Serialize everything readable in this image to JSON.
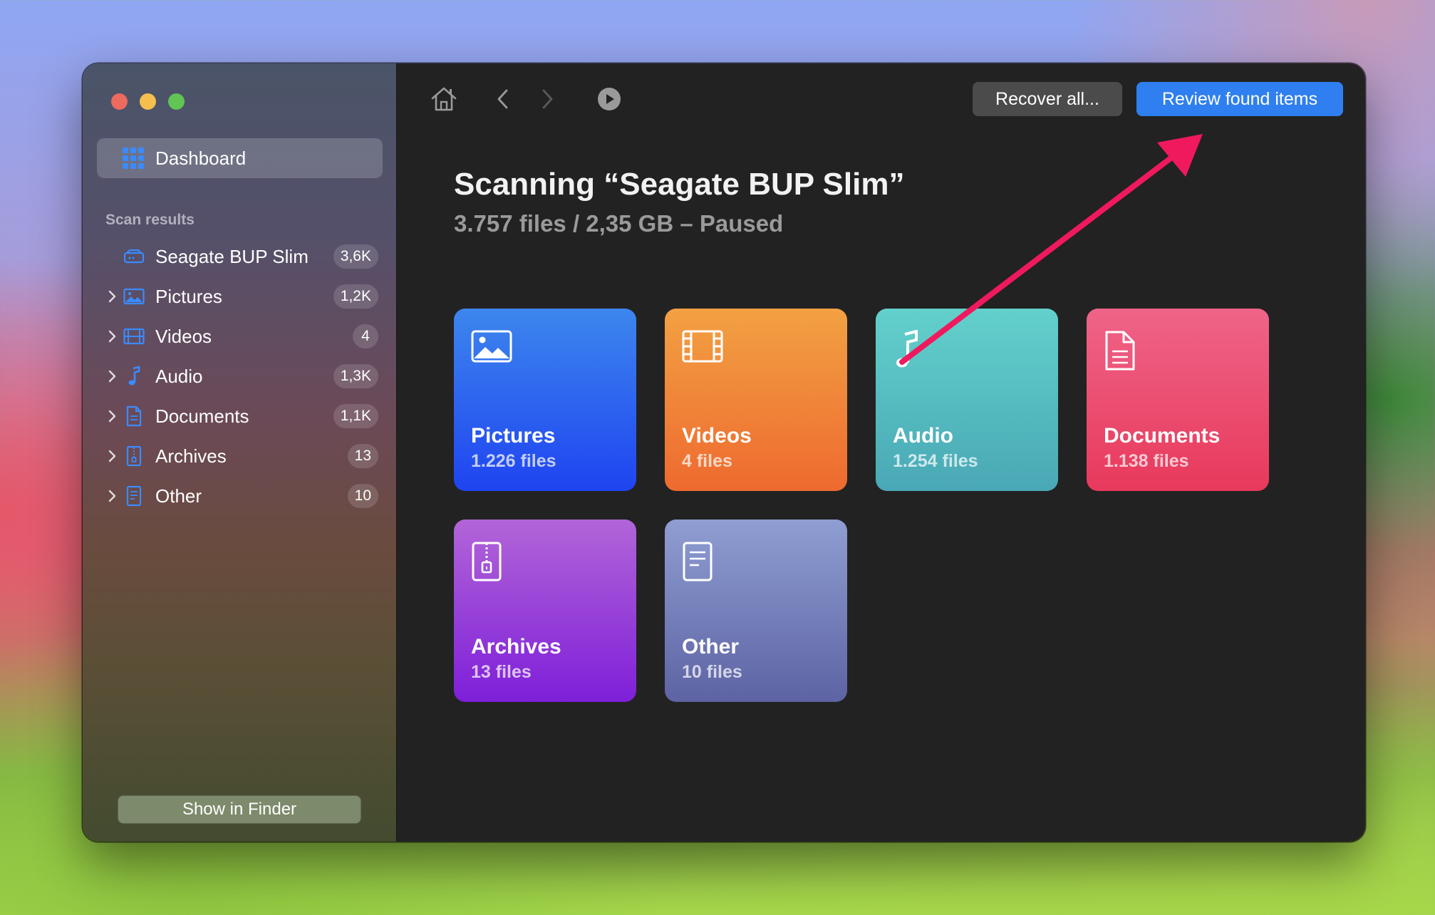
{
  "window": {
    "controls": [
      "close",
      "minimize",
      "zoom"
    ]
  },
  "sidebar": {
    "dashboard_label": "Dashboard",
    "section_label": "Scan results",
    "items": [
      {
        "label": "Seagate BUP Slim",
        "count": "3,6K",
        "icon": "drive-icon",
        "expandable": false
      },
      {
        "label": "Pictures",
        "count": "1,2K",
        "icon": "picture-icon",
        "expandable": true
      },
      {
        "label": "Videos",
        "count": "4",
        "icon": "film-icon",
        "expandable": true
      },
      {
        "label": "Audio",
        "count": "1,3K",
        "icon": "music-note-icon",
        "expandable": true
      },
      {
        "label": "Documents",
        "count": "1,1K",
        "icon": "document-icon",
        "expandable": true
      },
      {
        "label": "Archives",
        "count": "13",
        "icon": "archive-icon",
        "expandable": true
      },
      {
        "label": "Other",
        "count": "10",
        "icon": "file-icon",
        "expandable": true
      }
    ],
    "finder_button": "Show in Finder"
  },
  "toolbar": {
    "recover_label": "Recover all...",
    "review_label": "Review found items",
    "icons": [
      "home-icon",
      "back-icon",
      "forward-icon",
      "play-icon"
    ]
  },
  "main": {
    "title": "Scanning “Seagate BUP Slim”",
    "subtitle": "3.757 files / 2,35 GB – Paused",
    "cards": [
      {
        "name": "Pictures",
        "count": "1.226 files"
      },
      {
        "name": "Videos",
        "count": "4 files"
      },
      {
        "name": "Audio",
        "count": "1.254 files"
      },
      {
        "name": "Documents",
        "count": "1.138 files"
      },
      {
        "name": "Archives",
        "count": "13 files"
      },
      {
        "name": "Other",
        "count": "10 files"
      }
    ]
  },
  "colors": {
    "accent": "#2f7ff0",
    "annotation_arrow": "#f0195e"
  }
}
